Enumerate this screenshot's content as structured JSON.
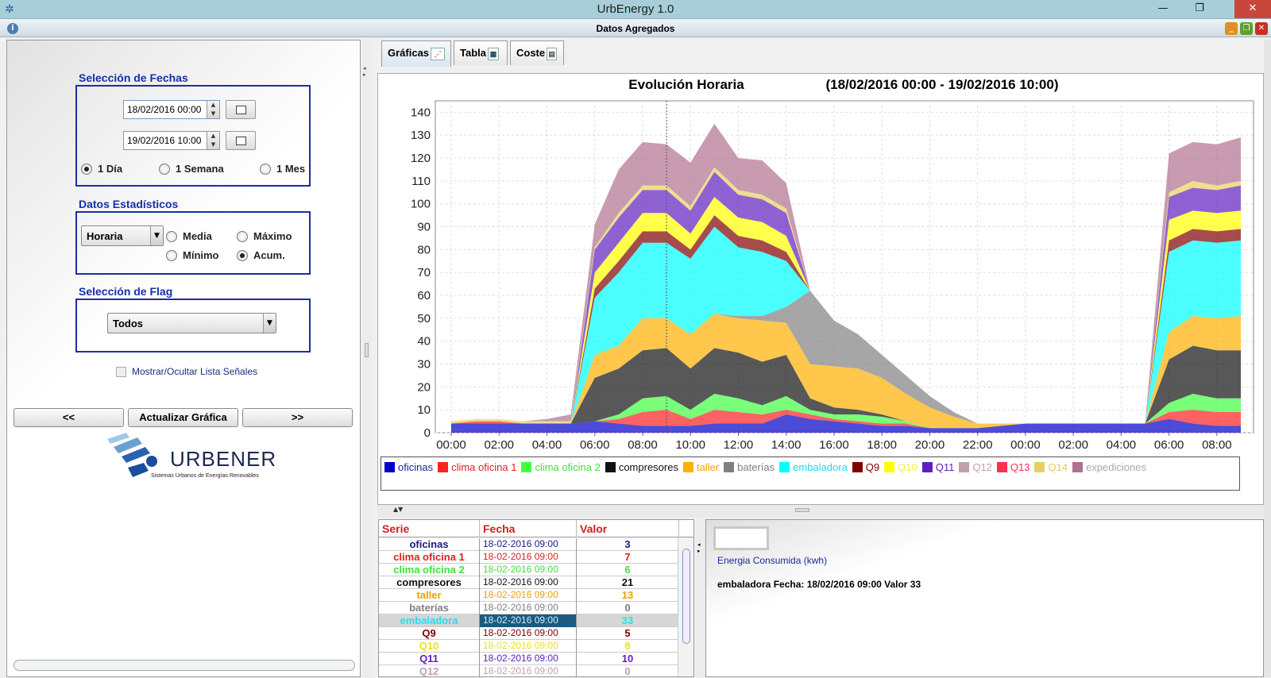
{
  "window": {
    "title": "UrbEnergy 1.0",
    "minimize_icon": "minimize-icon",
    "restore_icon": "restore-icon",
    "close_icon": "close-icon"
  },
  "frame": {
    "title": "Datos Agregados"
  },
  "left": {
    "dates": {
      "title": "Selección de Fechas",
      "start": "18/02/2016 00:00",
      "end": "19/02/2016 10:00",
      "ranges": [
        {
          "label": "1 Día",
          "selected": true
        },
        {
          "label": "1 Semana",
          "selected": false
        },
        {
          "label": "1 Mes",
          "selected": false
        }
      ]
    },
    "stats": {
      "title": "Datos Estadísticos",
      "interval": "Horaria",
      "options": [
        {
          "label": "Media",
          "selected": false
        },
        {
          "label": "Máximo",
          "selected": false
        },
        {
          "label": "Mínimo",
          "selected": false
        },
        {
          "label": "Acum.",
          "selected": true
        }
      ]
    },
    "flag": {
      "title": "Selección de Flag",
      "value": "Todos"
    },
    "toggle_signals": "Mostrar/Ocultar Lista Señales",
    "prev": "<<",
    "update": "Actualizar Gráfica",
    "next": ">>",
    "logo": {
      "name": "URBENER",
      "tagline": "Sistemas Urbanos de Energías Renovables"
    }
  },
  "tabs": [
    {
      "label": "Gráficas",
      "active": true
    },
    {
      "label": "Tabla",
      "active": false
    },
    {
      "label": "Coste",
      "active": false
    }
  ],
  "chart_data": {
    "type": "area",
    "stacked": true,
    "title": "Evolución Horaria",
    "subtitle": "(18/02/2016 00:00 - 19/02/2016 10:00)",
    "x": [
      "00:00",
      "01:00",
      "02:00",
      "03:00",
      "04:00",
      "05:00",
      "06:00",
      "07:00",
      "08:00",
      "09:00",
      "10:00",
      "11:00",
      "12:00",
      "13:00",
      "14:00",
      "15:00",
      "16:00",
      "17:00",
      "18:00",
      "19:00",
      "20:00",
      "21:00",
      "22:00",
      "23:00",
      "00:00",
      "01:00",
      "02:00",
      "03:00",
      "04:00",
      "05:00",
      "06:00",
      "07:00",
      "08:00",
      "09:00"
    ],
    "x_tick_labels": [
      "00:00",
      "02:00",
      "04:00",
      "06:00",
      "08:00",
      "10:00",
      "12:00",
      "14:00",
      "16:00",
      "18:00",
      "20:00",
      "22:00",
      "00:00",
      "02:00",
      "04:00",
      "06:00",
      "08:00"
    ],
    "ylim": [
      0,
      145
    ],
    "yticks": [
      0,
      10,
      20,
      30,
      40,
      50,
      60,
      70,
      80,
      90,
      100,
      110,
      120,
      130,
      140
    ],
    "grid": true,
    "crosshair_x": "09:00",
    "legend_position": "bottom",
    "series": [
      {
        "name": "oficinas",
        "color": "#0000c8",
        "values": [
          4,
          4,
          4,
          4,
          4,
          4,
          5,
          4,
          3,
          3,
          3,
          4,
          4,
          4,
          8,
          6,
          5,
          4,
          3,
          3,
          2,
          2,
          2,
          3,
          4,
          4,
          4,
          4,
          4,
          4,
          6,
          4,
          3,
          3
        ]
      },
      {
        "name": "clima oficina 1",
        "color": "#ff2020",
        "values": [
          0,
          1,
          1,
          0,
          0,
          0,
          0,
          2,
          6,
          7,
          3,
          6,
          5,
          4,
          2,
          2,
          1,
          1,
          1,
          1,
          0,
          0,
          0,
          0,
          0,
          0,
          0,
          0,
          0,
          0,
          3,
          6,
          6,
          6
        ]
      },
      {
        "name": "clima oficina 2",
        "color": "#40ff40",
        "values": [
          0,
          0,
          0,
          0,
          0,
          0,
          0,
          2,
          6,
          6,
          4,
          7,
          6,
          4,
          6,
          2,
          2,
          3,
          3,
          1,
          0,
          0,
          0,
          0,
          0,
          0,
          0,
          0,
          0,
          0,
          4,
          7,
          6,
          6
        ]
      },
      {
        "name": "compresores",
        "color": "#111111",
        "values": [
          0,
          0,
          0,
          0,
          0,
          0,
          19,
          20,
          21,
          21,
          18,
          20,
          20,
          19,
          18,
          5,
          3,
          2,
          1,
          0,
          0,
          0,
          0,
          0,
          0,
          0,
          0,
          0,
          0,
          0,
          19,
          21,
          21,
          21
        ]
      },
      {
        "name": "taller",
        "color": "#ffb000",
        "values": [
          0,
          0,
          0,
          0,
          0,
          0,
          10,
          10,
          14,
          13,
          15,
          15,
          15,
          18,
          14,
          15,
          18,
          18,
          16,
          12,
          9,
          5,
          2,
          1,
          0,
          0,
          0,
          0,
          0,
          0,
          12,
          13,
          14,
          15
        ]
      },
      {
        "name": "baterías",
        "color": "#808080",
        "values": [
          0,
          0,
          0,
          0,
          0,
          0,
          0,
          0,
          0,
          0,
          0,
          0,
          1,
          2,
          7,
          32,
          20,
          15,
          10,
          8,
          5,
          2,
          0,
          0,
          0,
          0,
          0,
          0,
          0,
          0,
          0,
          0,
          0,
          0
        ]
      },
      {
        "name": "embaladora",
        "color": "#00ffff",
        "values": [
          0,
          0,
          0,
          0,
          0,
          0,
          25,
          32,
          33,
          33,
          33,
          38,
          30,
          28,
          20,
          0,
          0,
          0,
          0,
          0,
          0,
          0,
          0,
          0,
          0,
          0,
          0,
          0,
          0,
          0,
          35,
          33,
          33,
          33
        ]
      },
      {
        "name": "Q9",
        "color": "#800000",
        "values": [
          0,
          0,
          0,
          0,
          0,
          0,
          4,
          5,
          5,
          5,
          4,
          5,
          5,
          5,
          4,
          0,
          0,
          0,
          0,
          0,
          0,
          0,
          0,
          0,
          0,
          0,
          0,
          0,
          0,
          0,
          5,
          5,
          5,
          5
        ]
      },
      {
        "name": "Q10",
        "color": "#ffff00",
        "values": [
          0,
          0,
          0,
          0,
          0,
          0,
          7,
          8,
          8,
          8,
          7,
          8,
          8,
          8,
          7,
          0,
          0,
          0,
          0,
          0,
          0,
          0,
          0,
          0,
          0,
          0,
          0,
          0,
          0,
          0,
          9,
          8,
          8,
          8
        ]
      },
      {
        "name": "Q11",
        "color": "#6020c0",
        "values": [
          0,
          0,
          0,
          0,
          0,
          0,
          10,
          11,
          10,
          10,
          10,
          11,
          10,
          10,
          10,
          0,
          0,
          0,
          0,
          0,
          0,
          0,
          0,
          0,
          0,
          0,
          0,
          0,
          0,
          0,
          10,
          10,
          10,
          11
        ]
      },
      {
        "name": "Q12",
        "color": "#c0a0b0",
        "values": [
          0,
          0,
          0,
          0,
          0,
          0,
          0,
          0,
          0,
          0,
          0,
          0,
          0,
          0,
          0,
          0,
          0,
          0,
          0,
          0,
          0,
          0,
          0,
          0,
          0,
          0,
          0,
          0,
          0,
          0,
          0,
          0,
          0,
          0
        ]
      },
      {
        "name": "Q13",
        "color": "#ff3050",
        "values": [
          0,
          0,
          0,
          0,
          0,
          0,
          0,
          0,
          0,
          0,
          0,
          0,
          0,
          0,
          0,
          0,
          0,
          0,
          0,
          0,
          0,
          0,
          0,
          0,
          0,
          0,
          0,
          0,
          0,
          0,
          0,
          0,
          0,
          0
        ]
      },
      {
        "name": "Q14",
        "color": "#e8d060",
        "values": [
          1,
          1,
          1,
          1,
          1,
          1,
          1,
          2,
          2,
          2,
          2,
          2,
          2,
          2,
          2,
          0,
          0,
          0,
          0,
          0,
          0,
          0,
          0,
          0,
          0,
          0,
          0,
          0,
          0,
          0,
          2,
          3,
          2,
          2
        ]
      },
      {
        "name": "expediciones",
        "color": "#b07090",
        "values": [
          0,
          0,
          0,
          0,
          1,
          3,
          10,
          19,
          19,
          18,
          19,
          19,
          14,
          15,
          11,
          0,
          0,
          0,
          0,
          0,
          0,
          0,
          0,
          0,
          0,
          0,
          0,
          0,
          0,
          0,
          17,
          17,
          18,
          19
        ]
      }
    ]
  },
  "legend_items": [
    {
      "name": "oficinas",
      "color": "#0000c8",
      "text_color": "#1a2a9a"
    },
    {
      "name": "clima oficina 1",
      "color": "#ff2020",
      "text_color": "#e02020"
    },
    {
      "name": "clima oficina 2",
      "color": "#40ff40",
      "text_color": "#40e040"
    },
    {
      "name": "compresores",
      "color": "#111111",
      "text_color": "#111111"
    },
    {
      "name": "taller",
      "color": "#ffb000",
      "text_color": "#f0a000"
    },
    {
      "name": "baterías",
      "color": "#808080",
      "text_color": "#808080"
    },
    {
      "name": "embaladora",
      "color": "#00ffff",
      "text_color": "#20d8f0"
    },
    {
      "name": "Q9",
      "color": "#800000",
      "text_color": "#800000"
    },
    {
      "name": "Q10",
      "color": "#ffff00",
      "text_color": "#f0f040"
    },
    {
      "name": "Q11",
      "color": "#6020c0",
      "text_color": "#6020c0"
    },
    {
      "name": "Q12",
      "color": "#c0a0b0",
      "text_color": "#c0a0b0"
    },
    {
      "name": "Q13",
      "color": "#ff3050",
      "text_color": "#ff3050"
    },
    {
      "name": "Q14",
      "color": "#e8d060",
      "text_color": "#e8c860"
    },
    {
      "name": "expediciones",
      "color": "#b07090",
      "text_color": "#b0a0b0"
    }
  ],
  "table": {
    "headers": [
      "Serie",
      "Fecha",
      "Valor"
    ],
    "rows": [
      {
        "serie": "oficinas",
        "fecha": "18-02-2016 09:00",
        "valor": "3",
        "color": "#1a1a80"
      },
      {
        "serie": "clima oficina 1",
        "fecha": "18-02-2016 09:00",
        "valor": "7",
        "color": "#e02020"
      },
      {
        "serie": "clima oficina 2",
        "fecha": "18-02-2016 09:00",
        "valor": "6",
        "color": "#40e040"
      },
      {
        "serie": "compresores",
        "fecha": "18-02-2016 09:00",
        "valor": "21",
        "color": "#111111"
      },
      {
        "serie": "taller",
        "fecha": "18-02-2016 09:00",
        "valor": "13",
        "color": "#f0a000"
      },
      {
        "serie": "baterías",
        "fecha": "18-02-2016 09:00",
        "valor": "0",
        "color": "#808080"
      },
      {
        "serie": "embaladora",
        "fecha": "18-02-2016 09:00",
        "valor": "33",
        "color": "#20e0f0",
        "selected": true
      },
      {
        "serie": "Q9",
        "fecha": "18-02-2016 09:00",
        "valor": "5",
        "color": "#800000"
      },
      {
        "serie": "Q10",
        "fecha": "18-02-2016 09:00",
        "valor": "8",
        "color": "#f0e020"
      },
      {
        "serie": "Q11",
        "fecha": "18-02-2016 09:00",
        "valor": "10",
        "color": "#6020c0"
      },
      {
        "serie": "Q12",
        "fecha": "18-02-2016 09:00",
        "valor": "0",
        "color": "#c0a0b0"
      }
    ]
  },
  "info": {
    "unit": "Energia Consumida (kwh)",
    "detail": "embaladora Fecha: 18/02/2016 09:00 Valor 33"
  }
}
